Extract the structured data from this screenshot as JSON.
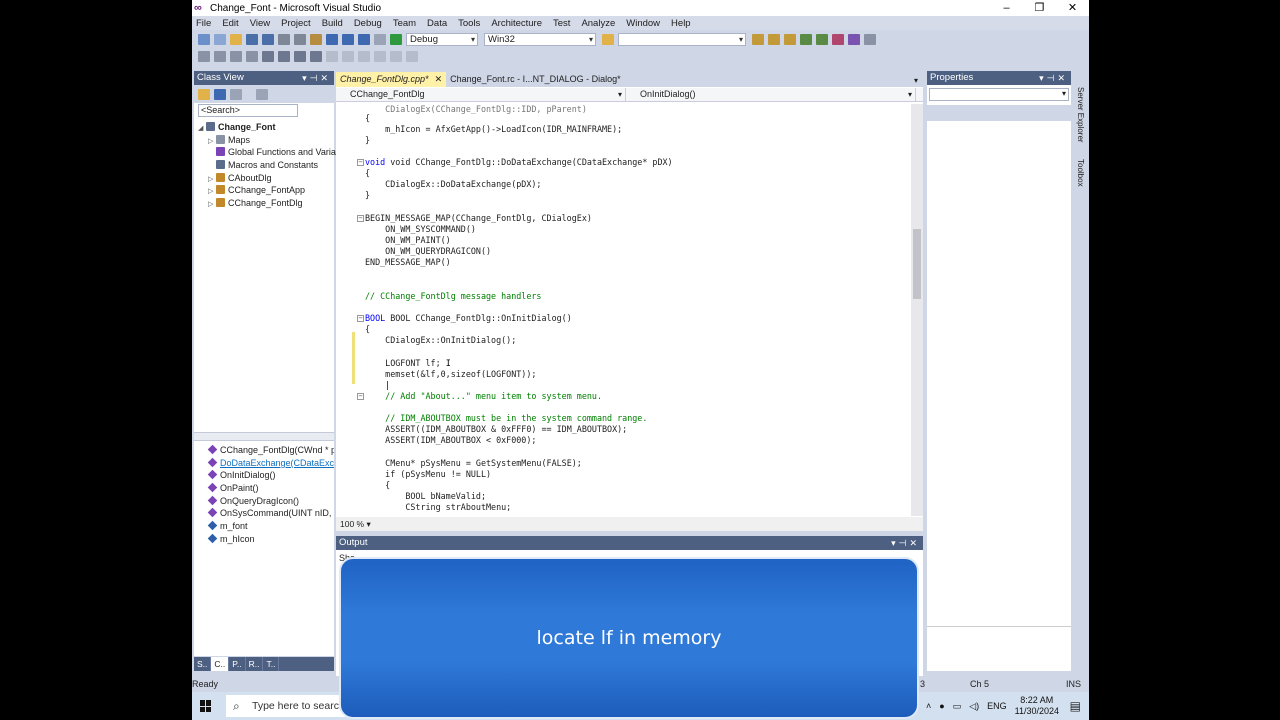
{
  "window_title": "Change_Font - Microsoft Visual Studio",
  "window_buttons": [
    "–",
    "❐",
    "✕"
  ],
  "menu": [
    "File",
    "Edit",
    "View",
    "Project",
    "Build",
    "Debug",
    "Team",
    "Data",
    "Tools",
    "Architecture",
    "Test",
    "Analyze",
    "Window",
    "Help"
  ],
  "toolbar": {
    "config": "Debug",
    "platform": "Win32",
    "find": ""
  },
  "class_view": {
    "title": "Class View",
    "search_placeholder": "<Search>",
    "tree": [
      "Change_Font",
      "Maps",
      "Global Functions and Variables",
      "Macros and Constants",
      "CAboutDlg",
      "CChange_FontApp",
      "CChange_FontDlg"
    ],
    "members": [
      "CChange_FontDlg(CWnd * pParent)",
      "DoDataExchange(CDataExchange * pDX)",
      "OnInitDialog()",
      "OnPaint()",
      "OnQueryDragIcon()",
      "OnSysCommand(UINT nID, LPARAM lParam)",
      "m_font",
      "m_hIcon"
    ],
    "tabs": [
      "S..",
      "C..",
      "P..",
      "R..",
      "T.."
    ]
  },
  "editor": {
    "tabs": [
      "Change_FontDlg.cpp*",
      "Change_Font.rc - I...NT_DIALOG - Dialog*"
    ],
    "nav_class": "CChange_FontDlg",
    "nav_member": "OnInitDialog()",
    "zoom": "100 %",
    "code": [
      "m_hIcon = AfxGetApp()->LoadIcon(IDR_MAINFRAME);",
      "void CChange_FontDlg::DoDataExchange(CDataExchange* pDX)",
      "CDialogEx::DoDataExchange(pDX);",
      "BEGIN_MESSAGE_MAP(CChange_FontDlg, CDialogEx)",
      "ON_WM_SYSCOMMAND()",
      "ON_WM_PAINT()",
      "ON_WM_QUERYDRAGICON()",
      "END_MESSAGE_MAP()",
      "// CChange_FontDlg message handlers",
      "BOOL CChange_FontDlg::OnInitDialog()",
      "CDialogEx::OnInitDialog();",
      "LOGFONT lf;",
      "memset(&lf,0,sizeof(LOGFONT));",
      "// Add \"About...\" menu item to system menu.",
      "// IDM_ABOUTBOX must be in the system command range.",
      "ASSERT((IDM_ABOUTBOX & 0xFFF0) == IDM_ABOUTBOX);",
      "ASSERT(IDM_ABOUTBOX < 0xF000);",
      "CMenu* pSysMenu = GetSystemMenu(FALSE);",
      "if (pSysMenu != NULL)",
      "BOOL bNameValid;",
      "CString strAboutMenu;"
    ]
  },
  "properties": {
    "title": "Properties"
  },
  "side_tabs": [
    "Server Explorer",
    "Toolbox"
  ],
  "output": {
    "title": "Output",
    "show_label": "Sho"
  },
  "status": {
    "ready": "Ready",
    "column": "Ch 5",
    "mode": "INS",
    "left_fragment": "3"
  },
  "taskbar": {
    "search": "Type here to search",
    "lang": "ENG",
    "time": "8:22 AM",
    "date": "11/30/2024"
  },
  "caption": "locate lf in memory",
  "colors": {
    "accent": "#4d6082",
    "tab_active": "#fff1a8",
    "caption_bg": "#2f79d8"
  }
}
